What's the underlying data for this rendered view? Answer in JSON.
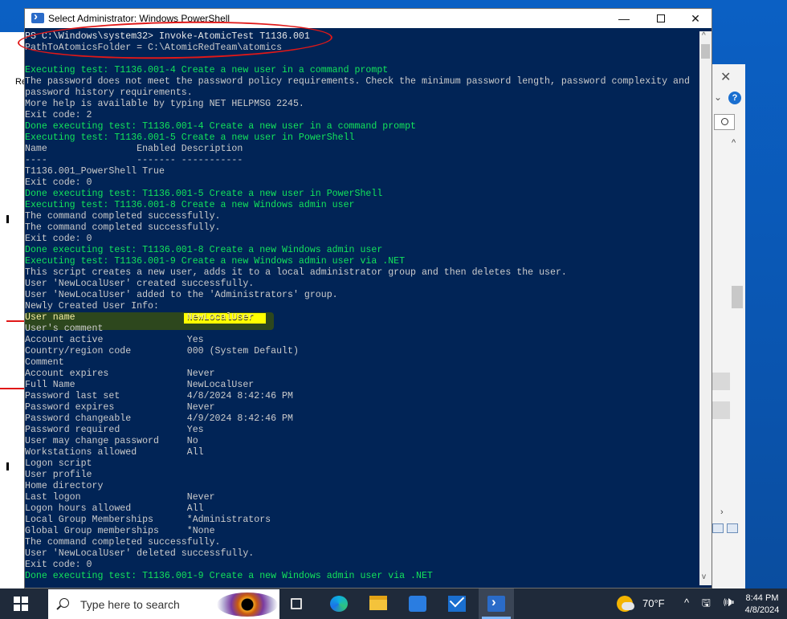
{
  "window": {
    "title": "Select Administrator: Windows PowerShell",
    "minimize": "—",
    "close": "✕"
  },
  "console_lines": [
    {
      "text": "PS C:\\Windows\\system32> Invoke-AtomicTest T1136.001",
      "style": "prompt"
    },
    {
      "text": "PathToAtomicsFolder = C:\\AtomicRedTeam\\atomics",
      "style": "normal"
    },
    {
      "text": "",
      "style": "normal"
    },
    {
      "text": "Executing test: T1136.001-4 Create a new user in a command prompt",
      "style": "green"
    },
    {
      "text": "The password does not meet the password policy requirements. Check the minimum password length, password complexity and",
      "style": "normal"
    },
    {
      "text": "password history requirements.",
      "style": "normal"
    },
    {
      "text": "More help is available by typing NET HELPMSG 2245.",
      "style": "normal"
    },
    {
      "text": "Exit code: 2",
      "style": "normal"
    },
    {
      "text": "Done executing test: T1136.001-4 Create a new user in a command prompt",
      "style": "green"
    },
    {
      "text": "Executing test: T1136.001-5 Create a new user in PowerShell",
      "style": "green"
    },
    {
      "text": "Name                Enabled Description",
      "style": "normal"
    },
    {
      "text": "----                ------- -----------",
      "style": "normal"
    },
    {
      "text": "T1136.001_PowerShell True",
      "style": "normal"
    },
    {
      "text": "Exit code: 0",
      "style": "normal"
    },
    {
      "text": "Done executing test: T1136.001-5 Create a new user in PowerShell",
      "style": "green"
    },
    {
      "text": "Executing test: T1136.001-8 Create a new Windows admin user",
      "style": "green"
    },
    {
      "text": "The command completed successfully.",
      "style": "normal"
    },
    {
      "text": "The command completed successfully.",
      "style": "normal"
    },
    {
      "text": "Exit code: 0",
      "style": "normal"
    },
    {
      "text": "Done executing test: T1136.001-8 Create a new Windows admin user",
      "style": "green"
    },
    {
      "text": "Executing test: T1136.001-9 Create a new Windows admin user via .NET",
      "style": "green"
    },
    {
      "text": "This script creates a new user, adds it to a local administrator group and then deletes the user.",
      "style": "normal"
    },
    {
      "text": "User 'NewLocalUser' created successfully.",
      "style": "normal"
    },
    {
      "text": "User 'NewLocalUser' added to the 'Administrators' group.",
      "style": "normal"
    },
    {
      "text": "Newly Created User Info:",
      "style": "normal"
    },
    {
      "text": "User name                    NewLocalUser",
      "style": "yellow"
    },
    {
      "text": "User's comment",
      "style": "normal"
    },
    {
      "text": "Account active               Yes",
      "style": "normal"
    },
    {
      "text": "Country/region code          000 (System Default)",
      "style": "normal"
    },
    {
      "text": "Comment",
      "style": "normal"
    },
    {
      "text": "Account expires              Never",
      "style": "normal"
    },
    {
      "text": "Full Name                    NewLocalUser",
      "style": "normal"
    },
    {
      "text": "Password last set            4/8/2024 8:42:46 PM",
      "style": "normal"
    },
    {
      "text": "Password expires             Never",
      "style": "normal"
    },
    {
      "text": "Password changeable          4/9/2024 8:42:46 PM",
      "style": "normal"
    },
    {
      "text": "Password required            Yes",
      "style": "normal"
    },
    {
      "text": "User may change password     No",
      "style": "normal"
    },
    {
      "text": "Workstations allowed         All",
      "style": "normal"
    },
    {
      "text": "Logon script",
      "style": "normal"
    },
    {
      "text": "User profile",
      "style": "normal"
    },
    {
      "text": "Home directory",
      "style": "normal"
    },
    {
      "text": "Last logon                   Never",
      "style": "normal"
    },
    {
      "text": "Logon hours allowed          All",
      "style": "normal"
    },
    {
      "text": "Local Group Memberships      *Administrators",
      "style": "normal"
    },
    {
      "text": "Global Group memberships     *None",
      "style": "normal"
    },
    {
      "text": "The command completed successfully.",
      "style": "normal"
    },
    {
      "text": "User 'NewLocalUser' deleted successfully.",
      "style": "normal"
    },
    {
      "text": "Exit code: 0",
      "style": "normal"
    },
    {
      "text": "Done executing test: T1136.001-9 Create a new Windows admin user via .NET",
      "style": "green"
    }
  ],
  "highlight_value": "NewLocalUser",
  "background_window": {
    "close": "✕",
    "help": "?"
  },
  "left_window_glyph": "Re",
  "taskbar": {
    "search_placeholder": "Type here to search",
    "weather": "70°F",
    "tray": "^ 🖫 🕪",
    "time": "8:44 PM",
    "date": "4/8/2024"
  },
  "colors": {
    "console_bg": "#012456",
    "console_text": "#cccccc",
    "green_text": "#13e45b",
    "yellow_text": "#f9f1a5",
    "annotation_red": "#e01818",
    "highlight_yellow": "#ffff00",
    "taskbar_bg": "#1f2a3a"
  },
  "icons": [
    "powershell-icon",
    "windows-start-icon",
    "search-icon",
    "task-view-icon",
    "edge-icon",
    "file-explorer-icon",
    "store-icon",
    "mail-icon",
    "weather-icon",
    "network-icon",
    "volume-icon"
  ]
}
